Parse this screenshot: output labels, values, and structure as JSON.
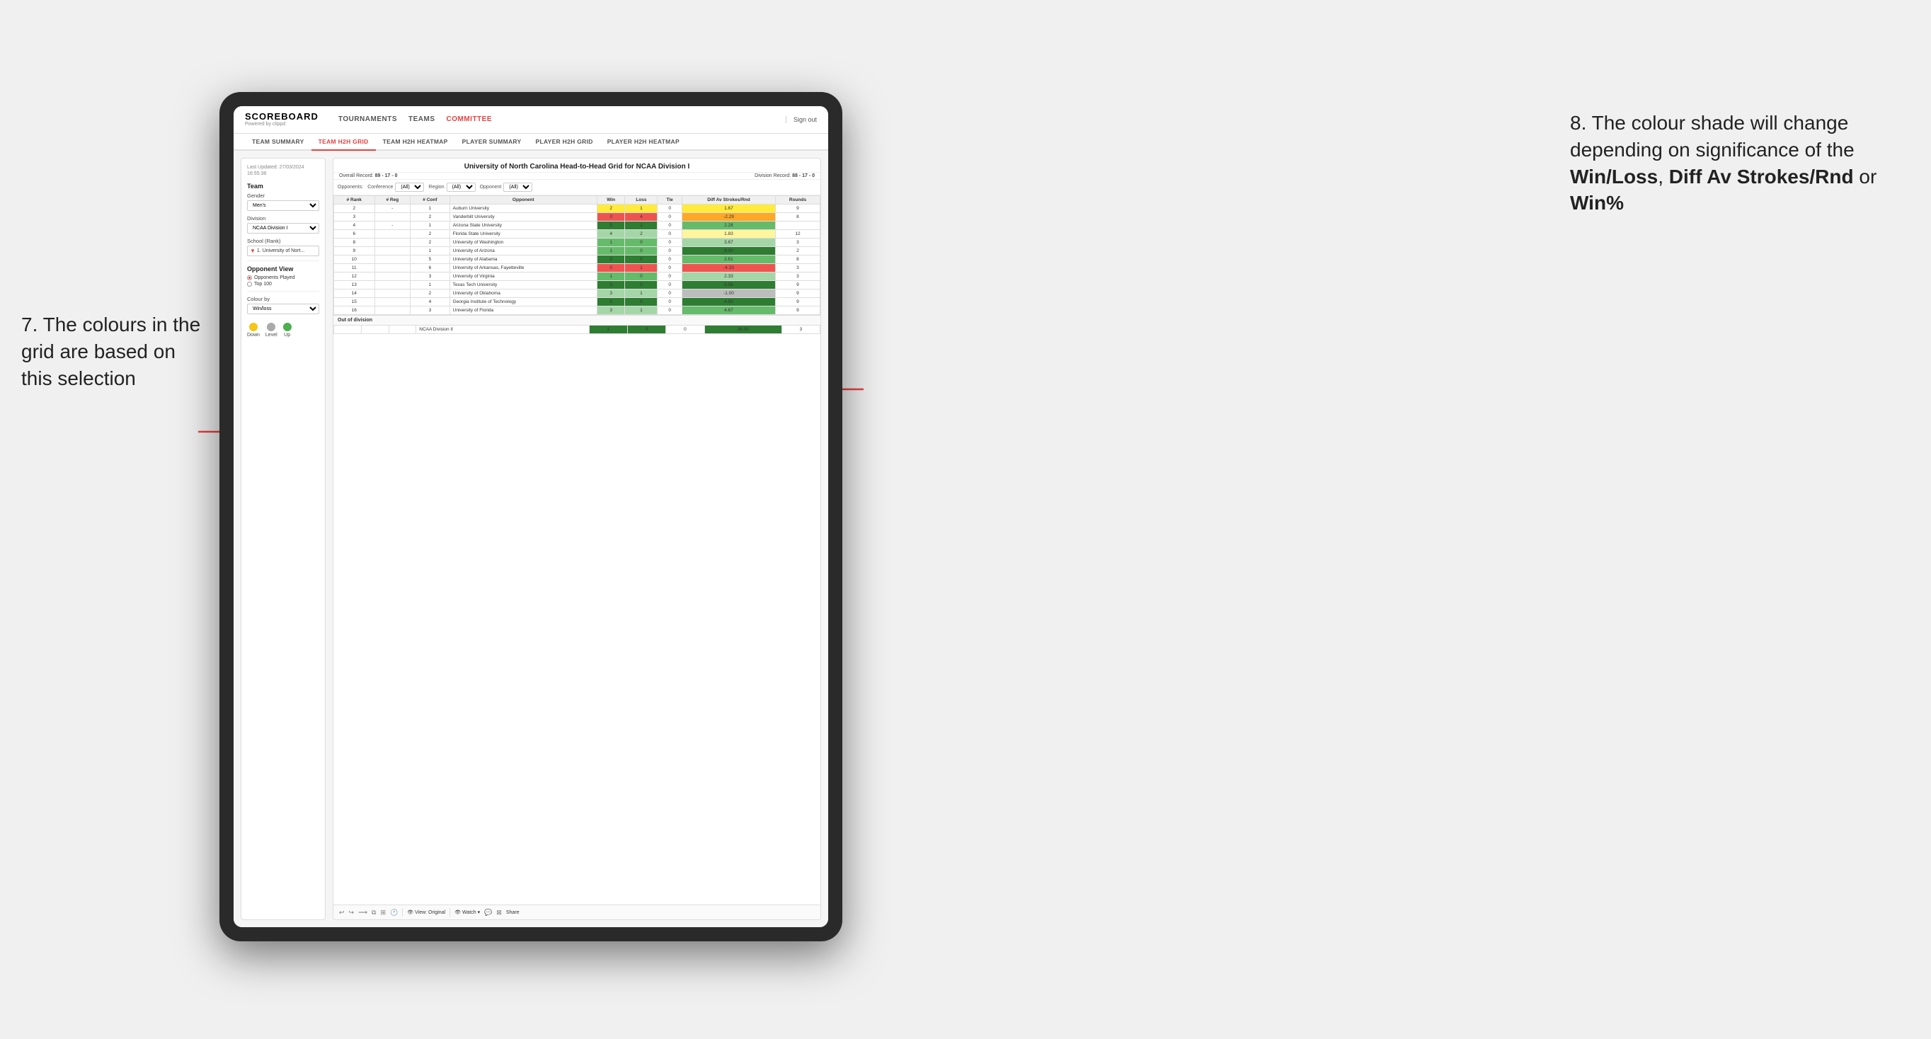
{
  "annotation_left": {
    "text": "7. The colours in the grid are based on this selection"
  },
  "annotation_right": {
    "text_before": "8. The colour shade will change depending on significance of the ",
    "bold1": "Win/Loss",
    "text_mid1": ", ",
    "bold2": "Diff Av Strokes/Rnd",
    "text_mid2": " or ",
    "bold3": "Win%"
  },
  "nav": {
    "logo_main": "SCOREBOARD",
    "logo_sub": "Powered by clippd",
    "links": [
      "TOURNAMENTS",
      "TEAMS",
      "COMMITTEE"
    ],
    "sign_out": "Sign out"
  },
  "sub_tabs": [
    {
      "label": "TEAM SUMMARY",
      "active": false
    },
    {
      "label": "TEAM H2H GRID",
      "active": true
    },
    {
      "label": "TEAM H2H HEATMAP",
      "active": false
    },
    {
      "label": "PLAYER SUMMARY",
      "active": false
    },
    {
      "label": "PLAYER H2H GRID",
      "active": false
    },
    {
      "label": "PLAYER H2H HEATMAP",
      "active": false
    }
  ],
  "sidebar": {
    "timestamp_label": "Last Updated: 27/03/2024",
    "timestamp_time": "16:55:38",
    "team_section": "Team",
    "gender_label": "Gender",
    "gender_value": "Men's",
    "division_label": "Division",
    "division_value": "NCAA Division I",
    "school_label": "School (Rank)",
    "school_value": "1. University of Nort...",
    "opponent_view_title": "Opponent View",
    "radio1": "Opponents Played",
    "radio2": "Top 100",
    "colour_by_label": "Colour by",
    "colour_by_value": "Win/loss",
    "legend_down": "Down",
    "legend_level": "Level",
    "legend_up": "Up"
  },
  "grid": {
    "title": "University of North Carolina Head-to-Head Grid for NCAA Division I",
    "overall_record_label": "Overall Record:",
    "overall_record_value": "89 - 17 - 0",
    "division_record_label": "Division Record:",
    "division_record_value": "88 - 17 - 0",
    "filter_opponents_label": "Opponents:",
    "filter_conference_label": "Conference",
    "filter_conference_value": "(All)",
    "filter_region_label": "Region",
    "filter_region_value": "(All)",
    "filter_opponent_label": "Opponent",
    "filter_opponent_value": "(All)",
    "col_rank": "#\nRank",
    "col_reg": "#\nReg",
    "col_conf": "#\nConf",
    "col_opponent": "Opponent",
    "col_win": "Win",
    "col_loss": "Loss",
    "col_tie": "Tie",
    "col_diff_av": "Diff Av\nStrokes/Rnd",
    "col_rounds": "Rounds",
    "rows": [
      {
        "rank": "2",
        "reg": "-",
        "conf": "1",
        "opponent": "Auburn University",
        "win": "2",
        "loss": "1",
        "tie": "0",
        "diff": "1.67",
        "rounds": "9",
        "win_color": "yellow",
        "diff_color": "yellow"
      },
      {
        "rank": "3",
        "reg": "",
        "conf": "2",
        "opponent": "Vanderbilt University",
        "win": "0",
        "loss": "4",
        "tie": "0",
        "diff": "-2.29",
        "rounds": "8",
        "win_color": "red",
        "diff_color": "orange"
      },
      {
        "rank": "4",
        "reg": "-",
        "conf": "1",
        "opponent": "Arizona State University",
        "win": "5",
        "loss": "1",
        "tie": "0",
        "diff": "2.28",
        "rounds": "",
        "win_color": "green_dark",
        "diff_color": "green_med"
      },
      {
        "rank": "6",
        "reg": "",
        "conf": "2",
        "opponent": "Florida State University",
        "win": "4",
        "loss": "2",
        "tie": "0",
        "diff": "1.83",
        "rounds": "12",
        "win_color": "green_light",
        "diff_color": "yellow_light"
      },
      {
        "rank": "8",
        "reg": "",
        "conf": "2",
        "opponent": "University of Washington",
        "win": "1",
        "loss": "0",
        "tie": "0",
        "diff": "3.67",
        "rounds": "3",
        "win_color": "green_med",
        "diff_color": "green_light"
      },
      {
        "rank": "9",
        "reg": "",
        "conf": "1",
        "opponent": "University of Arizona",
        "win": "1",
        "loss": "0",
        "tie": "0",
        "diff": "9.00",
        "rounds": "2",
        "win_color": "green_med",
        "diff_color": "green_dark"
      },
      {
        "rank": "10",
        "reg": "",
        "conf": "5",
        "opponent": "University of Alabama",
        "win": "3",
        "loss": "0",
        "tie": "0",
        "diff": "2.61",
        "rounds": "8",
        "win_color": "green_dark",
        "diff_color": "green_med"
      },
      {
        "rank": "11",
        "reg": "",
        "conf": "6",
        "opponent": "University of Arkansas, Fayetteville",
        "win": "0",
        "loss": "1",
        "tie": "0",
        "diff": "-4.33",
        "rounds": "3",
        "win_color": "red",
        "diff_color": "red"
      },
      {
        "rank": "12",
        "reg": "",
        "conf": "3",
        "opponent": "University of Virginia",
        "win": "1",
        "loss": "0",
        "tie": "0",
        "diff": "2.33",
        "rounds": "3",
        "win_color": "green_med",
        "diff_color": "green_light"
      },
      {
        "rank": "13",
        "reg": "",
        "conf": "1",
        "opponent": "Texas Tech University",
        "win": "3",
        "loss": "0",
        "tie": "0",
        "diff": "5.56",
        "rounds": "9",
        "win_color": "green_dark",
        "diff_color": "green_dark"
      },
      {
        "rank": "14",
        "reg": "",
        "conf": "2",
        "opponent": "University of Oklahoma",
        "win": "3",
        "loss": "1",
        "tie": "0",
        "diff": "-1.00",
        "rounds": "9",
        "win_color": "green_light",
        "diff_color": "gray"
      },
      {
        "rank": "15",
        "reg": "",
        "conf": "4",
        "opponent": "Georgia Institute of Technology",
        "win": "5",
        "loss": "0",
        "tie": "0",
        "diff": "4.50",
        "rounds": "9",
        "win_color": "green_dark",
        "diff_color": "green_dark"
      },
      {
        "rank": "16",
        "reg": "",
        "conf": "3",
        "opponent": "University of Florida",
        "win": "3",
        "loss": "1",
        "tie": "0",
        "diff": "4.67",
        "rounds": "9",
        "win_color": "green_light",
        "diff_color": "green_med"
      }
    ],
    "out_of_division_label": "Out of division",
    "out_of_division_row": {
      "label": "NCAA Division II",
      "win": "1",
      "loss": "0",
      "tie": "0",
      "diff": "26.00",
      "rounds": "3",
      "win_color": "green_dark",
      "diff_color": "green_dark"
    },
    "toolbar": {
      "view_label": "View: Original",
      "watch_label": "Watch",
      "share_label": "Share"
    }
  }
}
